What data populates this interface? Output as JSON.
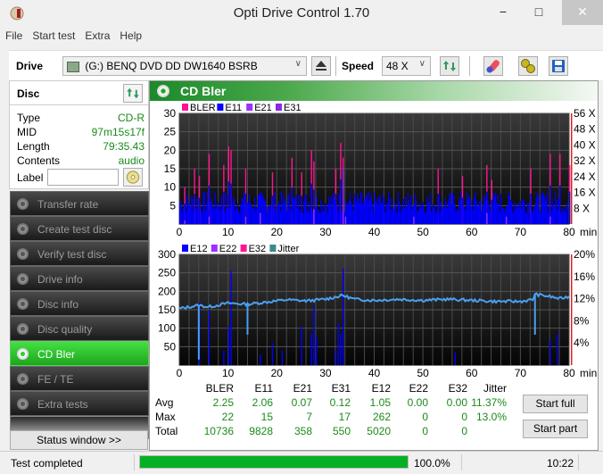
{
  "window": {
    "title": "Opti Drive Control 1.70",
    "minimize": "−",
    "maximize": "□",
    "close": "✕"
  },
  "menu": [
    "File",
    "Start test",
    "Extra",
    "Help"
  ],
  "toolbar": {
    "drive_label": "Drive",
    "drive_value": "(G:)   BENQ DVD DD DW1640 BSRB",
    "speed_label": "Speed",
    "speed_value": "48 X",
    "icons": [
      "eject-icon",
      "refresh-icon",
      "erase-icon",
      "settings-icon",
      "save-icon"
    ]
  },
  "disc": {
    "title": "Disc",
    "fields": [
      {
        "key": "Type",
        "value": "CD-R"
      },
      {
        "key": "MID",
        "value": "97m15s17f"
      },
      {
        "key": "Length",
        "value": "79:35.43"
      },
      {
        "key": "Contents",
        "value": "audio"
      }
    ],
    "label_key": "Label",
    "label_value": ""
  },
  "nav": [
    {
      "label": "Transfer rate",
      "active": false
    },
    {
      "label": "Create test disc",
      "active": false
    },
    {
      "label": "Verify test disc",
      "active": false
    },
    {
      "label": "Drive info",
      "active": false
    },
    {
      "label": "Disc info",
      "active": false
    },
    {
      "label": "Disc quality",
      "active": false
    },
    {
      "label": "CD Bler",
      "active": true
    },
    {
      "label": "FE / TE",
      "active": false
    },
    {
      "label": "Extra tests",
      "active": false
    }
  ],
  "status_window_button": "Status window >>",
  "panel": {
    "title": "CD Bler"
  },
  "chart_data": [
    {
      "type": "bar",
      "title": "BLER / E11 / E21 / E31",
      "legend": [
        {
          "name": "BLER",
          "color": "#ff1493"
        },
        {
          "name": "E11",
          "color": "#0000ff"
        },
        {
          "name": "E21",
          "color": "#9b30ff"
        },
        {
          "name": "E31",
          "color": "#8a2be2"
        }
      ],
      "xlabel": "min",
      "xlim": [
        0,
        80
      ],
      "x_ticks": [
        0,
        10,
        20,
        30,
        40,
        50,
        60,
        70,
        80
      ],
      "ylim": [
        0,
        30
      ],
      "y_ticks": [
        5,
        10,
        15,
        20,
        25,
        30
      ],
      "y2_ticks": [
        "8 X",
        "16 X",
        "24 X",
        "32 X",
        "40 X",
        "48 X",
        "56 X"
      ],
      "peaks": [
        {
          "x": 1,
          "bler": 10
        },
        {
          "x": 3,
          "bler": 15
        },
        {
          "x": 4,
          "bler": 13
        },
        {
          "x": 6,
          "bler": 19
        },
        {
          "x": 9,
          "bler": 16
        },
        {
          "x": 10,
          "bler": 21
        },
        {
          "x": 10.5,
          "bler": 20
        },
        {
          "x": 13.5,
          "bler": 15
        },
        {
          "x": 19,
          "bler": 14
        },
        {
          "x": 23,
          "bler": 18
        },
        {
          "x": 25,
          "bler": 14
        },
        {
          "x": 27,
          "bler": 20
        },
        {
          "x": 27.5,
          "bler": 17
        },
        {
          "x": 32,
          "bler": 15
        },
        {
          "x": 33,
          "bler": 22
        },
        {
          "x": 33.5,
          "bler": 18
        },
        {
          "x": 53,
          "bler": 15
        },
        {
          "x": 58,
          "bler": 13
        },
        {
          "x": 63,
          "bler": 16
        },
        {
          "x": 64,
          "bler": 12
        },
        {
          "x": 72,
          "bler": 15
        },
        {
          "x": 76,
          "bler": 19
        },
        {
          "x": 78,
          "bler": 19
        },
        {
          "x": 80,
          "bler": 16
        }
      ],
      "base_level": 5,
      "vertical_marker_x": 80.5
    },
    {
      "type": "bar+line",
      "title": "E12 / E22 / E32 / Jitter",
      "legend": [
        {
          "name": "E12",
          "color": "#0000ff"
        },
        {
          "name": "E22",
          "color": "#9b30ff"
        },
        {
          "name": "E32",
          "color": "#ff1493"
        },
        {
          "name": "Jitter",
          "color": "#3a8a8a"
        }
      ],
      "xlabel": "min",
      "xlim": [
        0,
        80
      ],
      "x_ticks": [
        0,
        10,
        20,
        30,
        40,
        50,
        60,
        70,
        80
      ],
      "ylim": [
        0,
        300
      ],
      "y_ticks": [
        50,
        100,
        150,
        200,
        250,
        300
      ],
      "y2lim": [
        0,
        20
      ],
      "y2_ticks": [
        "4%",
        "8%",
        "12%",
        "16%",
        "20%"
      ],
      "e12_spikes": [
        {
          "x": 4,
          "v": 170
        },
        {
          "x": 6,
          "v": 150
        },
        {
          "x": 9,
          "v": 40
        },
        {
          "x": 10,
          "v": 105
        },
        {
          "x": 10.5,
          "v": 255
        },
        {
          "x": 16.5,
          "v": 30
        },
        {
          "x": 19,
          "v": 60
        },
        {
          "x": 21,
          "v": 40
        },
        {
          "x": 25,
          "v": 105
        },
        {
          "x": 27,
          "v": 85
        },
        {
          "x": 27.5,
          "v": 160
        },
        {
          "x": 28,
          "v": 75
        },
        {
          "x": 32,
          "v": 40
        },
        {
          "x": 32.5,
          "v": 115
        },
        {
          "x": 33,
          "v": 85
        },
        {
          "x": 33.5,
          "v": 262
        },
        {
          "x": 56.5,
          "v": 35
        },
        {
          "x": 76,
          "v": 70
        },
        {
          "x": 77.5,
          "v": 85
        }
      ],
      "jitter_series": [
        {
          "x": 0,
          "v": 10.2
        },
        {
          "x": 4,
          "v": 10.8
        },
        {
          "x": 6,
          "v": 10.5
        },
        {
          "x": 10,
          "v": 11.2
        },
        {
          "x": 14,
          "v": 11.0
        },
        {
          "x": 18,
          "v": 11.4
        },
        {
          "x": 22,
          "v": 11.8
        },
        {
          "x": 26,
          "v": 11.6
        },
        {
          "x": 30,
          "v": 11.9
        },
        {
          "x": 33.5,
          "v": 12.6
        },
        {
          "x": 36,
          "v": 11.9
        },
        {
          "x": 40,
          "v": 11.7
        },
        {
          "x": 45,
          "v": 11.9
        },
        {
          "x": 50,
          "v": 11.7
        },
        {
          "x": 55,
          "v": 11.9
        },
        {
          "x": 60,
          "v": 11.7
        },
        {
          "x": 65,
          "v": 11.5
        },
        {
          "x": 70,
          "v": 11.5
        },
        {
          "x": 72.5,
          "v": 11.8
        },
        {
          "x": 73,
          "v": 12.8
        },
        {
          "x": 76,
          "v": 12.4
        },
        {
          "x": 78,
          "v": 12.0
        },
        {
          "x": 80,
          "v": 12.4
        }
      ],
      "jitter_dips": [
        {
          "x": 4,
          "v": 1.0
        },
        {
          "x": 14,
          "v": 5.5
        },
        {
          "x": 73,
          "v": 5.5
        }
      ],
      "vertical_marker_x": 80.5
    }
  ],
  "stats": {
    "columns": [
      "BLER",
      "E11",
      "E21",
      "E31",
      "E12",
      "E22",
      "E32",
      "Jitter"
    ],
    "rows": [
      {
        "label": "Avg",
        "values": [
          "2.25",
          "2.06",
          "0.07",
          "0.12",
          "1.05",
          "0.00",
          "0.00",
          "11.37%"
        ]
      },
      {
        "label": "Max",
        "values": [
          "22",
          "15",
          "7",
          "17",
          "262",
          "0",
          "0",
          "13.0%"
        ]
      },
      {
        "label": "Total",
        "values": [
          "10736",
          "9828",
          "358",
          "550",
          "5020",
          "0",
          "0",
          ""
        ]
      }
    ]
  },
  "actions": {
    "start_full": "Start full",
    "start_part": "Start part"
  },
  "statusbar": {
    "message": "Test completed",
    "progress": 1.0,
    "progress_text": "100.0%",
    "time": "10:22"
  }
}
